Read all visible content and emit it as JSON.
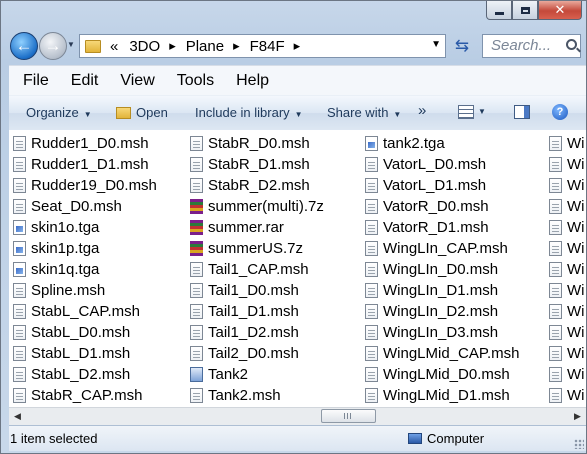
{
  "window": {
    "caption": {
      "minimize": "minimize",
      "maximize": "maximize",
      "close": "close"
    }
  },
  "address": {
    "overflow": "«",
    "crumbs": [
      "3DO",
      "Plane",
      "F84F"
    ],
    "search_placeholder": "Search..."
  },
  "menu": [
    "File",
    "Edit",
    "View",
    "Tools",
    "Help"
  ],
  "toolbar": {
    "organize": "Organize",
    "open": "Open",
    "include": "Include in library",
    "share": "Share with",
    "more": "»"
  },
  "files": [
    [
      {
        "name": "Rudder1_D0.msh",
        "icon": "document-icon"
      },
      {
        "name": "Rudder1_D1.msh",
        "icon": "document-icon"
      },
      {
        "name": "Rudder19_D0.msh",
        "icon": "document-icon"
      },
      {
        "name": "Seat_D0.msh",
        "icon": "document-icon"
      },
      {
        "name": "skin1o.tga",
        "icon": "image-file-icon"
      },
      {
        "name": "skin1p.tga",
        "icon": "image-file-icon"
      },
      {
        "name": "skin1q.tga",
        "icon": "image-file-icon"
      },
      {
        "name": "Spline.msh",
        "icon": "document-icon"
      },
      {
        "name": "StabL_CAP.msh",
        "icon": "document-icon"
      },
      {
        "name": "StabL_D0.msh",
        "icon": "document-icon"
      },
      {
        "name": "StabL_D1.msh",
        "icon": "document-icon"
      },
      {
        "name": "StabL_D2.msh",
        "icon": "document-icon"
      },
      {
        "name": "StabR_CAP.msh",
        "icon": "document-icon"
      }
    ],
    [
      {
        "name": "StabR_D0.msh",
        "icon": "document-icon"
      },
      {
        "name": "StabR_D1.msh",
        "icon": "document-icon"
      },
      {
        "name": "StabR_D2.msh",
        "icon": "document-icon"
      },
      {
        "name": "summer(multi).7z",
        "icon": "archive-icon"
      },
      {
        "name": "summer.rar",
        "icon": "archive-icon"
      },
      {
        "name": "summerUS.7z",
        "icon": "archive-icon"
      },
      {
        "name": "Tail1_CAP.msh",
        "icon": "document-icon"
      },
      {
        "name": "Tail1_D0.msh",
        "icon": "document-icon"
      },
      {
        "name": "Tail1_D1.msh",
        "icon": "document-icon"
      },
      {
        "name": "Tail1_D2.msh",
        "icon": "document-icon"
      },
      {
        "name": "Tail2_D0.msh",
        "icon": "document-icon"
      },
      {
        "name": "Tank2",
        "icon": "application-icon"
      },
      {
        "name": "Tank2.msh",
        "icon": "document-icon"
      }
    ],
    [
      {
        "name": "tank2.tga",
        "icon": "image-file-icon"
      },
      {
        "name": "VatorL_D0.msh",
        "icon": "document-icon"
      },
      {
        "name": "VatorL_D1.msh",
        "icon": "document-icon"
      },
      {
        "name": "VatorR_D0.msh",
        "icon": "document-icon"
      },
      {
        "name": "VatorR_D1.msh",
        "icon": "document-icon"
      },
      {
        "name": "WingLIn_CAP.msh",
        "icon": "document-icon"
      },
      {
        "name": "WingLIn_D0.msh",
        "icon": "document-icon"
      },
      {
        "name": "WingLIn_D1.msh",
        "icon": "document-icon"
      },
      {
        "name": "WingLIn_D2.msh",
        "icon": "document-icon"
      },
      {
        "name": "WingLIn_D3.msh",
        "icon": "document-icon"
      },
      {
        "name": "WingLMid_CAP.msh",
        "icon": "document-icon"
      },
      {
        "name": "WingLMid_D0.msh",
        "icon": "document-icon"
      },
      {
        "name": "WingLMid_D1.msh",
        "icon": "document-icon"
      }
    ],
    [
      {
        "name": "Wi",
        "icon": "document-icon"
      },
      {
        "name": "Wi",
        "icon": "document-icon"
      },
      {
        "name": "Wi",
        "icon": "document-icon"
      },
      {
        "name": "Wi",
        "icon": "document-icon"
      },
      {
        "name": "Wi",
        "icon": "document-icon"
      },
      {
        "name": "Wi",
        "icon": "document-icon"
      },
      {
        "name": "Wi",
        "icon": "document-icon"
      },
      {
        "name": "Wi",
        "icon": "document-icon"
      },
      {
        "name": "Wi",
        "icon": "document-icon"
      },
      {
        "name": "Wi",
        "icon": "document-icon"
      },
      {
        "name": "Wi",
        "icon": "document-icon"
      },
      {
        "name": "Wi",
        "icon": "document-icon"
      },
      {
        "name": "Wi",
        "icon": "document-icon"
      }
    ]
  ],
  "status": {
    "selection": "1 item selected",
    "location": "Computer"
  }
}
